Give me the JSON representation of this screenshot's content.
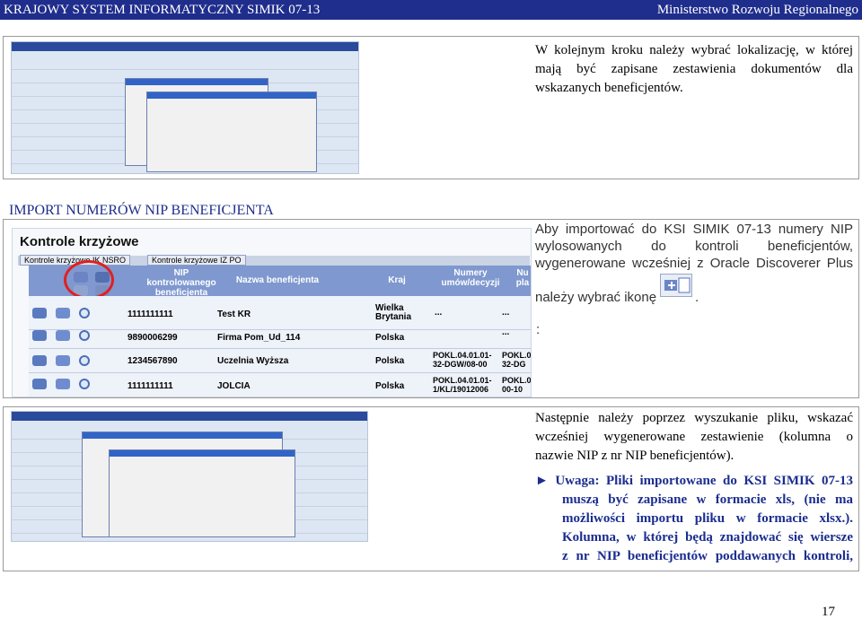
{
  "header": {
    "left": "KRAJOWY SYSTEM INFORMATYCZNY SIMIK 07-13",
    "right": "Ministerstwo Rozwoju Regionalnego"
  },
  "section1": {
    "text": "W kolejnym kroku należy wybrać lokalizację, w której mają być zapisane zestawienia dokumentów dla wskazanych beneficjentów.",
    "lines": [
      "W kolejnym kroku należy wybrać lokalizację, w której",
      "mają być zapisane zestawienia dokumentów dla",
      "wskazanych beneficjentów."
    ]
  },
  "section_title": "IMPORT NUMERÓW NIP BENEFICJENTA",
  "section2": {
    "lines": [
      "Aby importować do KSI SIMIK 07-13 numery NIP",
      "wylosowanych do kontroli beneficjentów,",
      "wygenerowane wcześniej z Oracle Discoverer Plus"
    ],
    "icon_line": "należy wybrać ikonę",
    "icon_line_end": ".",
    "colon": ":",
    "icon": "import-icon"
  },
  "screenshot": {
    "title": "Kontrole krzyżowe",
    "tabs": [
      "Kontrole krzyżowe IK NSRO",
      "Kontrole krzyżowe IZ PO"
    ],
    "columns": [
      "NIP kontrolowanego beneficjenta",
      "Nazwa beneficjenta",
      "Kraj",
      "Numery umów/decyzji",
      "Nu pla"
    ],
    "rows": [
      {
        "nip": "1111111111",
        "name": "Test KR",
        "country": "Wielka Brytania",
        "c4": "...",
        "c5": "..."
      },
      {
        "nip": "9890006299",
        "name": "Firma Pom_Ud_114",
        "country": "Polska",
        "c4": "",
        "c5": "..."
      },
      {
        "nip": "1234567890",
        "name": "Uczelnia Wyższa",
        "country": "Polska",
        "c4": "POKL.04.01.01-32-DGW/08-00",
        "c5": "POKL.0 32-DG"
      },
      {
        "nip": "1111111111",
        "name": "JOLCIA",
        "country": "Polska",
        "c4": "POKL.04.01.01-1/KL/19012006",
        "c5": "POKL.0 00-10"
      }
    ]
  },
  "section3": {
    "lines": [
      "Następnie należy poprzez wyszukanie pliku, wskazać",
      "wcześniej wygenerowane zestawienie (kolumna o"
    ],
    "last_line": "nazwie NIP z nr NIP beneficjentów).",
    "warning_lines": [
      "► Uwaga: Pliki importowane do KSI SIMIK 07-13",
      "muszą być zapisane w formacie xls, (nie ma",
      "możliwości importu pliku w formacie xlsx.).",
      "Kolumna, w której będą znajdować się wiersze",
      "z nr NIP beneficjentów poddawanych kontroli,"
    ]
  },
  "page_number": "17",
  "colors": {
    "header_bg": "#1f2d8c",
    "accent": "#1b2d8f",
    "circle": "#e02020"
  }
}
